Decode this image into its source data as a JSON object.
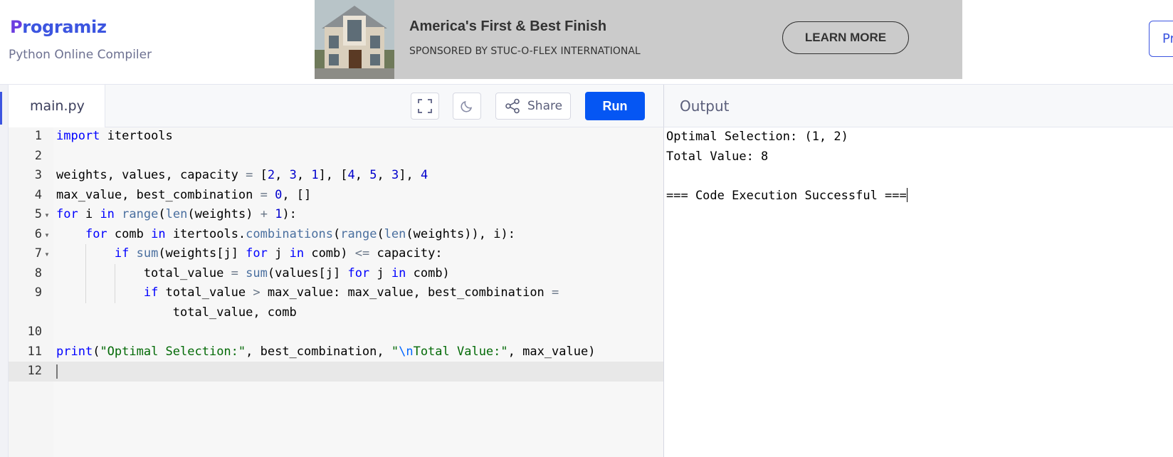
{
  "header": {
    "logo_text": "rogramiz",
    "logo_initial": "P",
    "subtitle": "Python Online Compiler",
    "premium_label": "Pr"
  },
  "ad": {
    "headline": "America's First & Best Finish",
    "sponsor": "SPONSORED BY STUC-O-FLEX INTERNATIONAL",
    "button_label": "LEARN MORE"
  },
  "editor": {
    "file_tab": "main.py",
    "share_label": "Share",
    "run_label": "Run",
    "line_numbers": [
      "1",
      "2",
      "3",
      "4",
      "5",
      "6",
      "7",
      "8",
      "9",
      "10",
      "11",
      "12"
    ]
  },
  "output": {
    "title": "Output",
    "lines": [
      "Optimal Selection: (1, 2)",
      "Total Value: 8",
      "",
      "=== Code Execution Successful ==="
    ]
  },
  "colors": {
    "brand": "#3c55e0",
    "run_button": "#0556f3",
    "keyword": "#0000ff",
    "string": "#036a07"
  },
  "icons": [
    "fullscreen-icon",
    "dark-mode-icon",
    "share-icon"
  ]
}
